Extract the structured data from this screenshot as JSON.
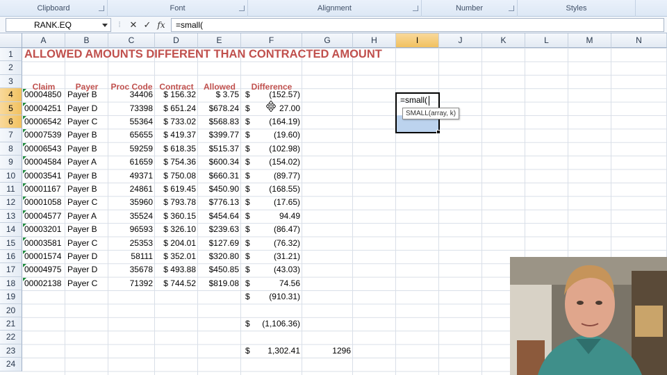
{
  "ribbon": {
    "groups": [
      {
        "label": "Clipboard"
      },
      {
        "label": "Font"
      },
      {
        "label": "Alignment"
      },
      {
        "label": "Number"
      },
      {
        "label": "Styles"
      }
    ]
  },
  "formula_bar": {
    "name_box": "RANK.EQ",
    "cancel_icon": "✕",
    "enter_icon": "✓",
    "fx_label": "fx",
    "formula": "=small("
  },
  "columns": [
    "A",
    "B",
    "C",
    "D",
    "E",
    "F",
    "G",
    "H",
    "I",
    "J",
    "K",
    "L",
    "M",
    "N"
  ],
  "rows": [
    "1",
    "2",
    "3",
    "4",
    "5",
    "6",
    "7",
    "8",
    "9",
    "10",
    "11",
    "12",
    "13",
    "14",
    "15",
    "16",
    "17",
    "18",
    "19",
    "20",
    "21",
    "22",
    "23",
    "24"
  ],
  "sheet": {
    "title": "ALLOWED AMOUNTS DIFFERENT THAN CONTRACTED AMOUNT",
    "headers": {
      "claim": "Claim",
      "payer": "Payer",
      "proc_code": "Proc Code",
      "contract": "Contract",
      "allowed": "Allowed",
      "difference": "Difference"
    },
    "data": [
      {
        "claim": "00004850",
        "payer": "Payer B",
        "proc": "34406",
        "contract": "$ 156.32",
        "allowed": "$    3.75",
        "dollar": "$",
        "diff": "(152.57)"
      },
      {
        "claim": "00004251",
        "payer": "Payer D",
        "proc": "73398",
        "contract": "$ 651.24",
        "allowed": "$678.24",
        "dollar": "$",
        "diff": "27.00"
      },
      {
        "claim": "00006542",
        "payer": "Payer C",
        "proc": "55364",
        "contract": "$ 733.02",
        "allowed": "$568.83",
        "dollar": "$",
        "diff": "(164.19)"
      },
      {
        "claim": "00007539",
        "payer": "Payer B",
        "proc": "65655",
        "contract": "$ 419.37",
        "allowed": "$399.77",
        "dollar": "$",
        "diff": "(19.60)"
      },
      {
        "claim": "00006543",
        "payer": "Payer B",
        "proc": "59259",
        "contract": "$ 618.35",
        "allowed": "$515.37",
        "dollar": "$",
        "diff": "(102.98)"
      },
      {
        "claim": "00004584",
        "payer": "Payer A",
        "proc": "61659",
        "contract": "$ 754.36",
        "allowed": "$600.34",
        "dollar": "$",
        "diff": "(154.02)"
      },
      {
        "claim": "00003541",
        "payer": "Payer B",
        "proc": "49371",
        "contract": "$ 750.08",
        "allowed": "$660.31",
        "dollar": "$",
        "diff": "(89.77)"
      },
      {
        "claim": "00001167",
        "payer": "Payer B",
        "proc": "24861",
        "contract": "$ 619.45",
        "allowed": "$450.90",
        "dollar": "$",
        "diff": "(168.55)"
      },
      {
        "claim": "00001058",
        "payer": "Payer C",
        "proc": "35960",
        "contract": "$ 793.78",
        "allowed": "$776.13",
        "dollar": "$",
        "diff": "(17.65)"
      },
      {
        "claim": "00004577",
        "payer": "Payer A",
        "proc": "35524",
        "contract": "$ 360.15",
        "allowed": "$454.64",
        "dollar": "$",
        "diff": "94.49"
      },
      {
        "claim": "00003201",
        "payer": "Payer B",
        "proc": "96593",
        "contract": "$ 326.10",
        "allowed": "$239.63",
        "dollar": "$",
        "diff": "(86.47)"
      },
      {
        "claim": "00003581",
        "payer": "Payer C",
        "proc": "25353",
        "contract": "$ 204.01",
        "allowed": "$127.69",
        "dollar": "$",
        "diff": "(76.32)"
      },
      {
        "claim": "00001574",
        "payer": "Payer D",
        "proc": "58111",
        "contract": "$ 352.01",
        "allowed": "$320.80",
        "dollar": "$",
        "diff": "(31.21)"
      },
      {
        "claim": "00004975",
        "payer": "Payer D",
        "proc": "35678",
        "contract": "$ 493.88",
        "allowed": "$450.85",
        "dollar": "$",
        "diff": "(43.03)"
      },
      {
        "claim": "00002138",
        "payer": "Payer C",
        "proc": "71392",
        "contract": "$ 744.52",
        "allowed": "$819.08",
        "dollar": "$",
        "diff": "74.56"
      }
    ],
    "row19": {
      "dollar": "$",
      "diff": "(910.31)"
    },
    "row21": {
      "dollar": "$",
      "diff": "(1,106.36)"
    },
    "row23": {
      "dollar": "$",
      "diff": "1,302.41",
      "g_value": "1296"
    },
    "active_cell_text": "=small(",
    "tooltip": "SMALL(array, k)"
  },
  "colors": {
    "accent_red": "#c0504d",
    "selection_fill": "#bcd3ee",
    "active_header": "#f1c15f"
  },
  "icons": {
    "cancel": "close-icon",
    "enter": "check-icon",
    "function": "function-icon",
    "dropdown": "chevron-down-icon",
    "cursor": "move-cursor-icon"
  }
}
